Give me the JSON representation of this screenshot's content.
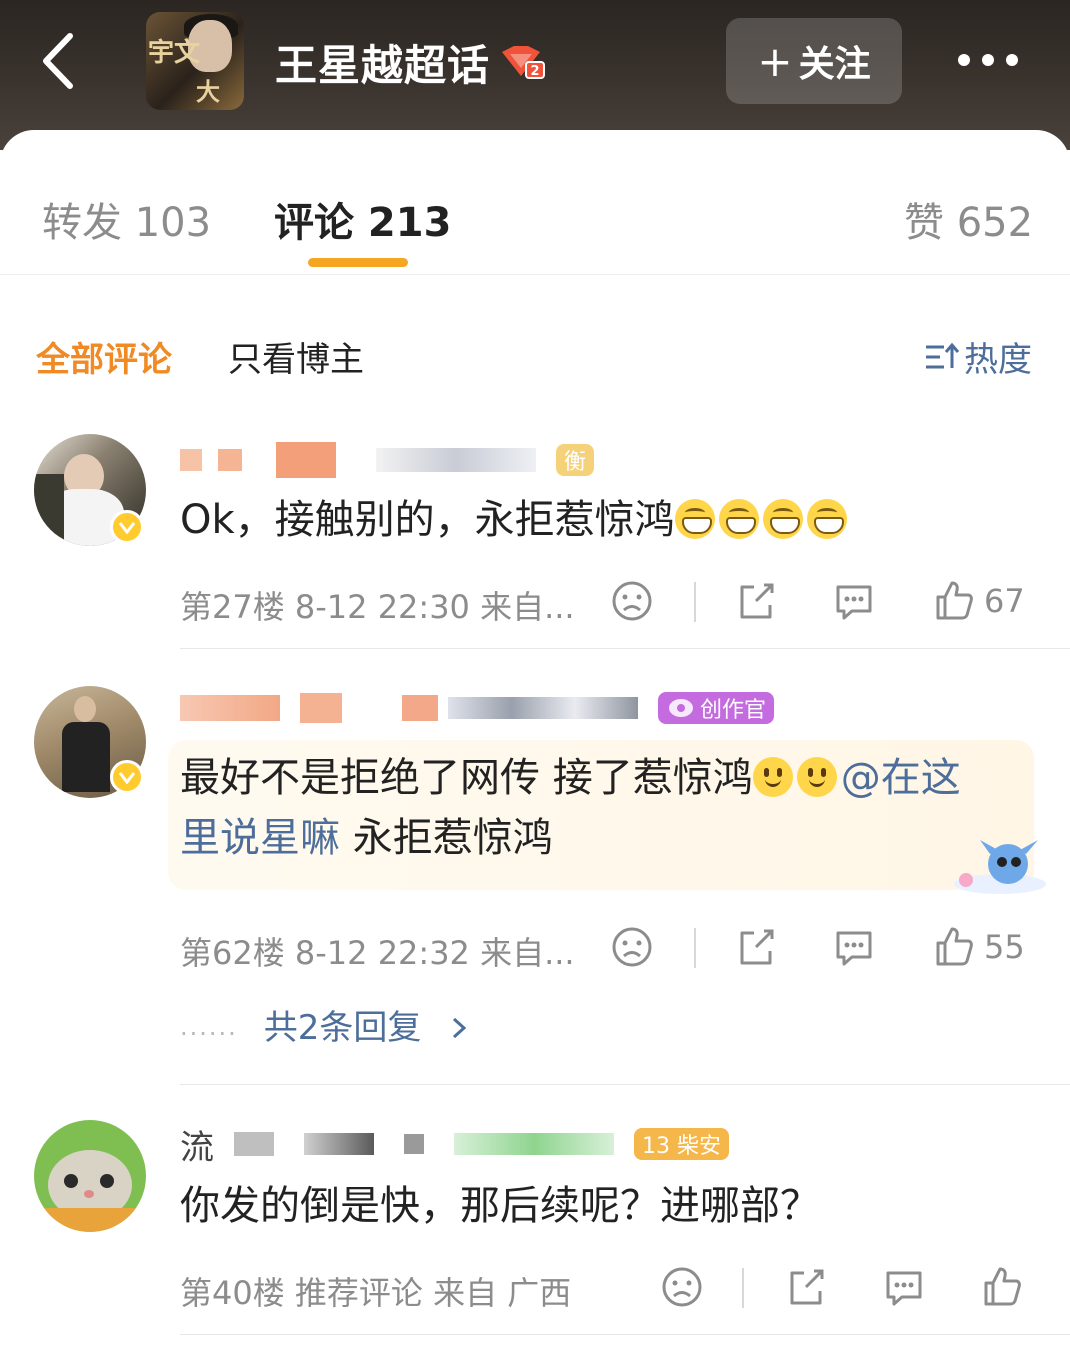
{
  "header": {
    "topic_title": "王星越超话",
    "topic_avatar_text_1": "宇文",
    "topic_avatar_text_2": "大",
    "badge_level": "2",
    "follow_label": "关注",
    "follow_plus": "+"
  },
  "tabs": [
    {
      "label": "转发 103"
    },
    {
      "label": "评论 213"
    },
    {
      "label": "赞 652"
    }
  ],
  "filters": {
    "all": "全部评论",
    "blogger_only": "只看博主",
    "sort": "热度"
  },
  "comments": [
    {
      "name_tag": "衡",
      "text": "Ok，接触别的，永拒惹惊鸿",
      "meta": "第27楼 8-12 22:30 来自...",
      "likes": "67"
    },
    {
      "name_tag": "创作官",
      "text_part1": "最好不是拒绝了网传 接了惹惊鸿",
      "mention": "@在这里说星嘛",
      "text_part2": " 永拒惹惊鸿",
      "meta": "第62楼 8-12 22:32 来自...",
      "likes": "55",
      "replies": "共2条回复",
      "replies_dots": "......"
    },
    {
      "name_prefix": "流",
      "name_tag": "13 柴安",
      "text": "你发的倒是快，那后续呢？进哪部？",
      "meta": "第40楼 推荐评论 来自 广西",
      "likes": ""
    }
  ],
  "colors": {
    "accent_orange": "#f08a24",
    "tab_underline": "#f5a623",
    "link_blue": "#4d6e9a",
    "gray_text": "#8c8c8c"
  }
}
